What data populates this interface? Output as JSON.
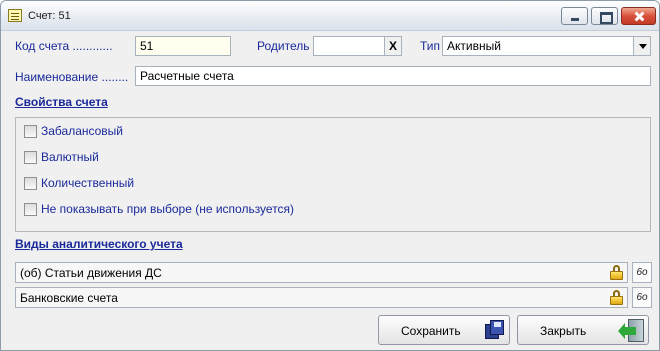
{
  "window": {
    "title": "Счет: 51"
  },
  "form": {
    "code_label": "Код счета",
    "code_dots": "............",
    "code_value": "51",
    "parent_label": "Родитель",
    "parent_value": "",
    "parent_clear": "X",
    "type_label": "Тип",
    "type_value": "Активный",
    "name_label": "Наименование",
    "name_dots": "........",
    "name_value": "Расчетные счета"
  },
  "properties": {
    "heading": "Свойства счета",
    "checkboxes": [
      {
        "label": "Забалансовый",
        "checked": false
      },
      {
        "label": "Валютный",
        "checked": false
      },
      {
        "label": "Количественный",
        "checked": false
      },
      {
        "label": "Не показывать при выборе (не используется)",
        "checked": false
      }
    ]
  },
  "analytics": {
    "heading": "Виды аналитического учета",
    "rows": [
      {
        "label": "(об) Статьи движения ДС",
        "icon": "lock-icon",
        "button": "glasses-icon"
      },
      {
        "label": "Банковские счета",
        "icon": "lock-icon",
        "button": "glasses-icon"
      }
    ],
    "glasses_glyph": "6o"
  },
  "buttons": {
    "save_label": "Сохранить",
    "close_label": "Закрыть"
  }
}
